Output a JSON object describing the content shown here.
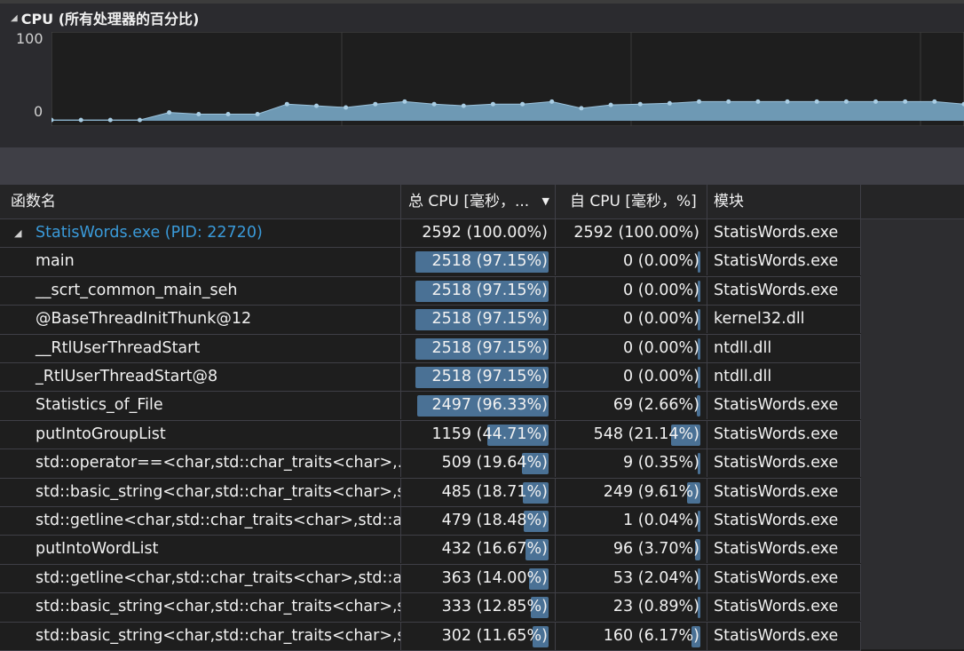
{
  "cpu_panel": {
    "title": "CPU (所有处理器的百分比)",
    "y_max_label": "100",
    "y_min_label": "0"
  },
  "chart_data": {
    "type": "area",
    "title": "CPU (所有处理器的百分比)",
    "ylim": [
      0,
      100
    ],
    "values": [
      1,
      1,
      1,
      1,
      10,
      8,
      8,
      8,
      20,
      18,
      16,
      20,
      23,
      20,
      18,
      20,
      20,
      23,
      15,
      19,
      20,
      21,
      23,
      23,
      23,
      23,
      23,
      23,
      23,
      23,
      23,
      20
    ],
    "color": "#6e99b4"
  },
  "table": {
    "headers": [
      "函数名",
      "总 CPU [毫秒，...",
      "自 CPU [毫秒，%]",
      "模块"
    ],
    "rows": [
      {
        "name": "StatisWords.exe (PID: 22720)",
        "total": "2592 (100.00%)",
        "self": "2592 (100.00%)",
        "module": "StatisWords.exe",
        "total_pct": 100.0,
        "self_pct": 100.0,
        "root": true
      },
      {
        "name": "main",
        "total": "2518 (97.15%)",
        "self": "0 (0.00%)",
        "module": "StatisWords.exe",
        "total_pct": 97.15,
        "self_pct": 0.0
      },
      {
        "name": "__scrt_common_main_seh",
        "total": "2518 (97.15%)",
        "self": "0 (0.00%)",
        "module": "StatisWords.exe",
        "total_pct": 97.15,
        "self_pct": 0.0
      },
      {
        "name": "@BaseThreadInitThunk@12",
        "total": "2518 (97.15%)",
        "self": "0 (0.00%)",
        "module": "kernel32.dll",
        "total_pct": 97.15,
        "self_pct": 0.0
      },
      {
        "name": "__RtlUserThreadStart",
        "total": "2518 (97.15%)",
        "self": "0 (0.00%)",
        "module": "ntdll.dll",
        "total_pct": 97.15,
        "self_pct": 0.0
      },
      {
        "name": "_RtlUserThreadStart@8",
        "total": "2518 (97.15%)",
        "self": "0 (0.00%)",
        "module": "ntdll.dll",
        "total_pct": 97.15,
        "self_pct": 0.0
      },
      {
        "name": "Statistics_of_File",
        "total": "2497 (96.33%)",
        "self": "69 (2.66%)",
        "module": "StatisWords.exe",
        "total_pct": 96.33,
        "self_pct": 2.66
      },
      {
        "name": "putIntoGroupList",
        "total": "1159 (44.71%)",
        "self": "548 (21.14%)",
        "module": "StatisWords.exe",
        "total_pct": 44.71,
        "self_pct": 21.14
      },
      {
        "name": "std::operator==<char,std::char_traits<char>,...",
        "total": "509 (19.64%)",
        "self": "9 (0.35%)",
        "module": "StatisWords.exe",
        "total_pct": 19.64,
        "self_pct": 0.35
      },
      {
        "name": "std::basic_string<char,std::char_traits<char>,s...",
        "total": "485 (18.71%)",
        "self": "249 (9.61%)",
        "module": "StatisWords.exe",
        "total_pct": 18.71,
        "self_pct": 9.61
      },
      {
        "name": "std::getline<char,std::char_traits<char>,std::al...",
        "total": "479 (18.48%)",
        "self": "1 (0.04%)",
        "module": "StatisWords.exe",
        "total_pct": 18.48,
        "self_pct": 0.04
      },
      {
        "name": "putIntoWordList",
        "total": "432 (16.67%)",
        "self": "96 (3.70%)",
        "module": "StatisWords.exe",
        "total_pct": 16.67,
        "self_pct": 3.7
      },
      {
        "name": "std::getline<char,std::char_traits<char>,std::al...",
        "total": "363 (14.00%)",
        "self": "53 (2.04%)",
        "module": "StatisWords.exe",
        "total_pct": 14.0,
        "self_pct": 2.04
      },
      {
        "name": "std::basic_string<char,std::char_traits<char>,s...",
        "total": "333 (12.85%)",
        "self": "23 (0.89%)",
        "module": "StatisWords.exe",
        "total_pct": 12.85,
        "self_pct": 0.89
      },
      {
        "name": "std::basic_string<char,std::char_traits<char>,s...",
        "total": "302 (11.65%)",
        "self": "160 (6.17%)",
        "module": "StatisWords.exe",
        "total_pct": 11.65,
        "self_pct": 6.17
      }
    ]
  }
}
